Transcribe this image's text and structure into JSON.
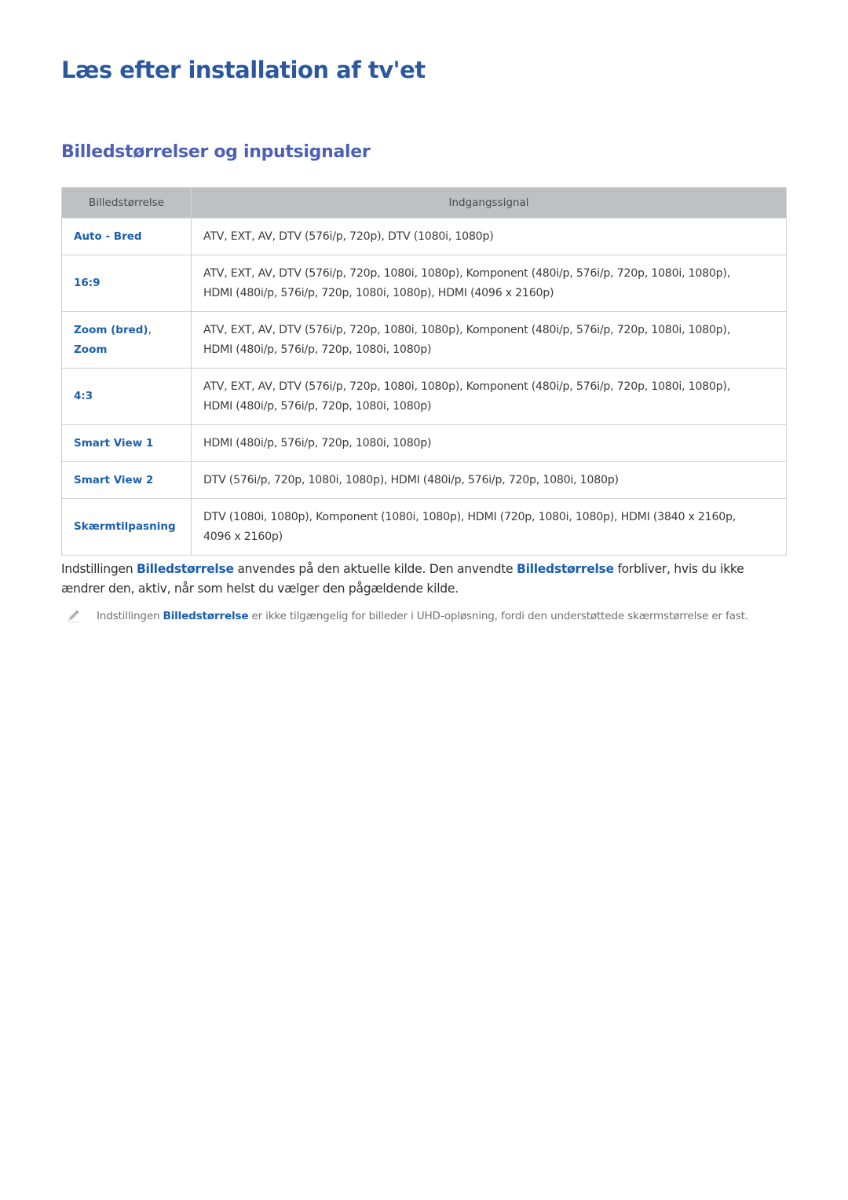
{
  "page": {
    "title": "Læs efter installation af tv'et",
    "section_title": "Billedstørrelser og inputsignaler"
  },
  "table": {
    "headers": [
      "Billedstørrelse",
      "Indgangssignal"
    ],
    "rows": [
      {
        "size": [
          "Auto - Bred"
        ],
        "signal": [
          "ATV, EXT, AV, DTV (576i/p, 720p), DTV (1080i, 1080p)"
        ]
      },
      {
        "size": [
          "16:9"
        ],
        "signal": [
          "ATV, EXT, AV, DTV (576i/p, 720p, 1080i, 1080p), Komponent (480i/p, 576i/p, 720p, 1080i, 1080p),",
          "HDMI (480i/p, 576i/p, 720p, 1080i, 1080p), HDMI (4096 x 2160p)"
        ]
      },
      {
        "size": [
          "Zoom (bred)",
          "Zoom"
        ],
        "size_sep": ",",
        "signal": [
          "ATV, EXT, AV, DTV (576i/p, 720p, 1080i, 1080p), Komponent (480i/p, 576i/p, 720p, 1080i, 1080p),",
          "HDMI (480i/p, 576i/p, 720p, 1080i, 1080p)"
        ]
      },
      {
        "size": [
          "4:3"
        ],
        "signal": [
          "ATV, EXT, AV, DTV (576i/p, 720p, 1080i, 1080p), Komponent (480i/p, 576i/p, 720p, 1080i, 1080p),",
          "HDMI (480i/p, 576i/p, 720p, 1080i, 1080p)"
        ]
      },
      {
        "size": [
          "Smart View 1"
        ],
        "signal": [
          "HDMI (480i/p, 576i/p, 720p, 1080i, 1080p)"
        ]
      },
      {
        "size": [
          "Smart View 2"
        ],
        "signal": [
          "DTV (576i/p, 720p, 1080i, 1080p), HDMI (480i/p, 576i/p, 720p, 1080i, 1080p)"
        ]
      },
      {
        "size": [
          "Skærmtilpasning"
        ],
        "signal": [
          "DTV (1080i, 1080p), Komponent (1080i, 1080p), HDMI (720p, 1080i, 1080p), HDMI (3840 x 2160p,",
          "4096 x 2160p)"
        ]
      }
    ]
  },
  "body": {
    "part1": "Indstillingen ",
    "kw1": "Billedstørrelse",
    "part2": " anvendes på den aktuelle kilde. Den anvendte ",
    "kw2": "Billedstørrelse",
    "part3": " forbliver, hvis du ikke ændrer den, aktiv, når som helst du vælger den pågældende kilde."
  },
  "note": {
    "icon": "pencil-icon",
    "part1": "Indstillingen ",
    "kw": "Billedstørrelse",
    "part2": " er ikke tilgængelig for billeder i UHD-opløsning, fordi den understøttede skærmstørrelse er fast."
  },
  "colors": {
    "title": "#2b57a0",
    "section_title": "#4b5fb8",
    "keyword": "#1b5fae",
    "header_bg": "#bfc0c2"
  }
}
